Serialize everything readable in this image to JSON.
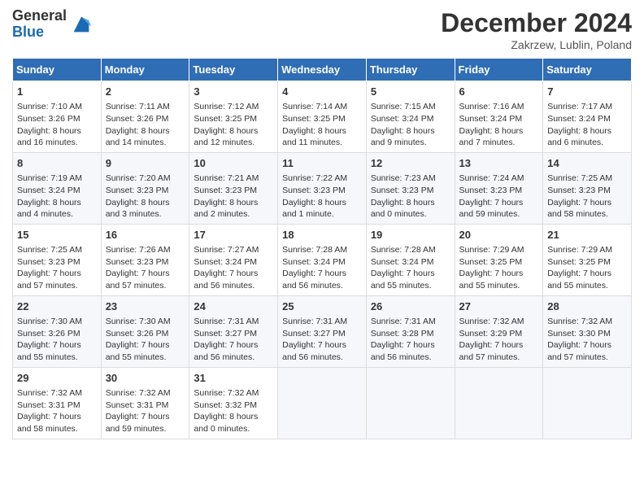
{
  "header": {
    "logo_general": "General",
    "logo_blue": "Blue",
    "month_year": "December 2024",
    "location": "Zakrzew, Lublin, Poland"
  },
  "days_of_week": [
    "Sunday",
    "Monday",
    "Tuesday",
    "Wednesday",
    "Thursday",
    "Friday",
    "Saturday"
  ],
  "weeks": [
    [
      {
        "day": "1",
        "sunrise": "7:10 AM",
        "sunset": "3:26 PM",
        "daylight": "8 hours and 16 minutes."
      },
      {
        "day": "2",
        "sunrise": "7:11 AM",
        "sunset": "3:26 PM",
        "daylight": "8 hours and 14 minutes."
      },
      {
        "day": "3",
        "sunrise": "7:12 AM",
        "sunset": "3:25 PM",
        "daylight": "8 hours and 12 minutes."
      },
      {
        "day": "4",
        "sunrise": "7:14 AM",
        "sunset": "3:25 PM",
        "daylight": "8 hours and 11 minutes."
      },
      {
        "day": "5",
        "sunrise": "7:15 AM",
        "sunset": "3:24 PM",
        "daylight": "8 hours and 9 minutes."
      },
      {
        "day": "6",
        "sunrise": "7:16 AM",
        "sunset": "3:24 PM",
        "daylight": "8 hours and 7 minutes."
      },
      {
        "day": "7",
        "sunrise": "7:17 AM",
        "sunset": "3:24 PM",
        "daylight": "8 hours and 6 minutes."
      }
    ],
    [
      {
        "day": "8",
        "sunrise": "7:19 AM",
        "sunset": "3:24 PM",
        "daylight": "8 hours and 4 minutes."
      },
      {
        "day": "9",
        "sunrise": "7:20 AM",
        "sunset": "3:23 PM",
        "daylight": "8 hours and 3 minutes."
      },
      {
        "day": "10",
        "sunrise": "7:21 AM",
        "sunset": "3:23 PM",
        "daylight": "8 hours and 2 minutes."
      },
      {
        "day": "11",
        "sunrise": "7:22 AM",
        "sunset": "3:23 PM",
        "daylight": "8 hours and 1 minute."
      },
      {
        "day": "12",
        "sunrise": "7:23 AM",
        "sunset": "3:23 PM",
        "daylight": "8 hours and 0 minutes."
      },
      {
        "day": "13",
        "sunrise": "7:24 AM",
        "sunset": "3:23 PM",
        "daylight": "7 hours and 59 minutes."
      },
      {
        "day": "14",
        "sunrise": "7:25 AM",
        "sunset": "3:23 PM",
        "daylight": "7 hours and 58 minutes."
      }
    ],
    [
      {
        "day": "15",
        "sunrise": "7:25 AM",
        "sunset": "3:23 PM",
        "daylight": "7 hours and 57 minutes."
      },
      {
        "day": "16",
        "sunrise": "7:26 AM",
        "sunset": "3:23 PM",
        "daylight": "7 hours and 57 minutes."
      },
      {
        "day": "17",
        "sunrise": "7:27 AM",
        "sunset": "3:24 PM",
        "daylight": "7 hours and 56 minutes."
      },
      {
        "day": "18",
        "sunrise": "7:28 AM",
        "sunset": "3:24 PM",
        "daylight": "7 hours and 56 minutes."
      },
      {
        "day": "19",
        "sunrise": "7:28 AM",
        "sunset": "3:24 PM",
        "daylight": "7 hours and 55 minutes."
      },
      {
        "day": "20",
        "sunrise": "7:29 AM",
        "sunset": "3:25 PM",
        "daylight": "7 hours and 55 minutes."
      },
      {
        "day": "21",
        "sunrise": "7:29 AM",
        "sunset": "3:25 PM",
        "daylight": "7 hours and 55 minutes."
      }
    ],
    [
      {
        "day": "22",
        "sunrise": "7:30 AM",
        "sunset": "3:26 PM",
        "daylight": "7 hours and 55 minutes."
      },
      {
        "day": "23",
        "sunrise": "7:30 AM",
        "sunset": "3:26 PM",
        "daylight": "7 hours and 55 minutes."
      },
      {
        "day": "24",
        "sunrise": "7:31 AM",
        "sunset": "3:27 PM",
        "daylight": "7 hours and 56 minutes."
      },
      {
        "day": "25",
        "sunrise": "7:31 AM",
        "sunset": "3:27 PM",
        "daylight": "7 hours and 56 minutes."
      },
      {
        "day": "26",
        "sunrise": "7:31 AM",
        "sunset": "3:28 PM",
        "daylight": "7 hours and 56 minutes."
      },
      {
        "day": "27",
        "sunrise": "7:32 AM",
        "sunset": "3:29 PM",
        "daylight": "7 hours and 57 minutes."
      },
      {
        "day": "28",
        "sunrise": "7:32 AM",
        "sunset": "3:30 PM",
        "daylight": "7 hours and 57 minutes."
      }
    ],
    [
      {
        "day": "29",
        "sunrise": "7:32 AM",
        "sunset": "3:31 PM",
        "daylight": "7 hours and 58 minutes."
      },
      {
        "day": "30",
        "sunrise": "7:32 AM",
        "sunset": "3:31 PM",
        "daylight": "7 hours and 59 minutes."
      },
      {
        "day": "31",
        "sunrise": "7:32 AM",
        "sunset": "3:32 PM",
        "daylight": "8 hours and 0 minutes."
      },
      null,
      null,
      null,
      null
    ]
  ],
  "labels": {
    "sunrise": "Sunrise:",
    "sunset": "Sunset:",
    "daylight": "Daylight:"
  }
}
